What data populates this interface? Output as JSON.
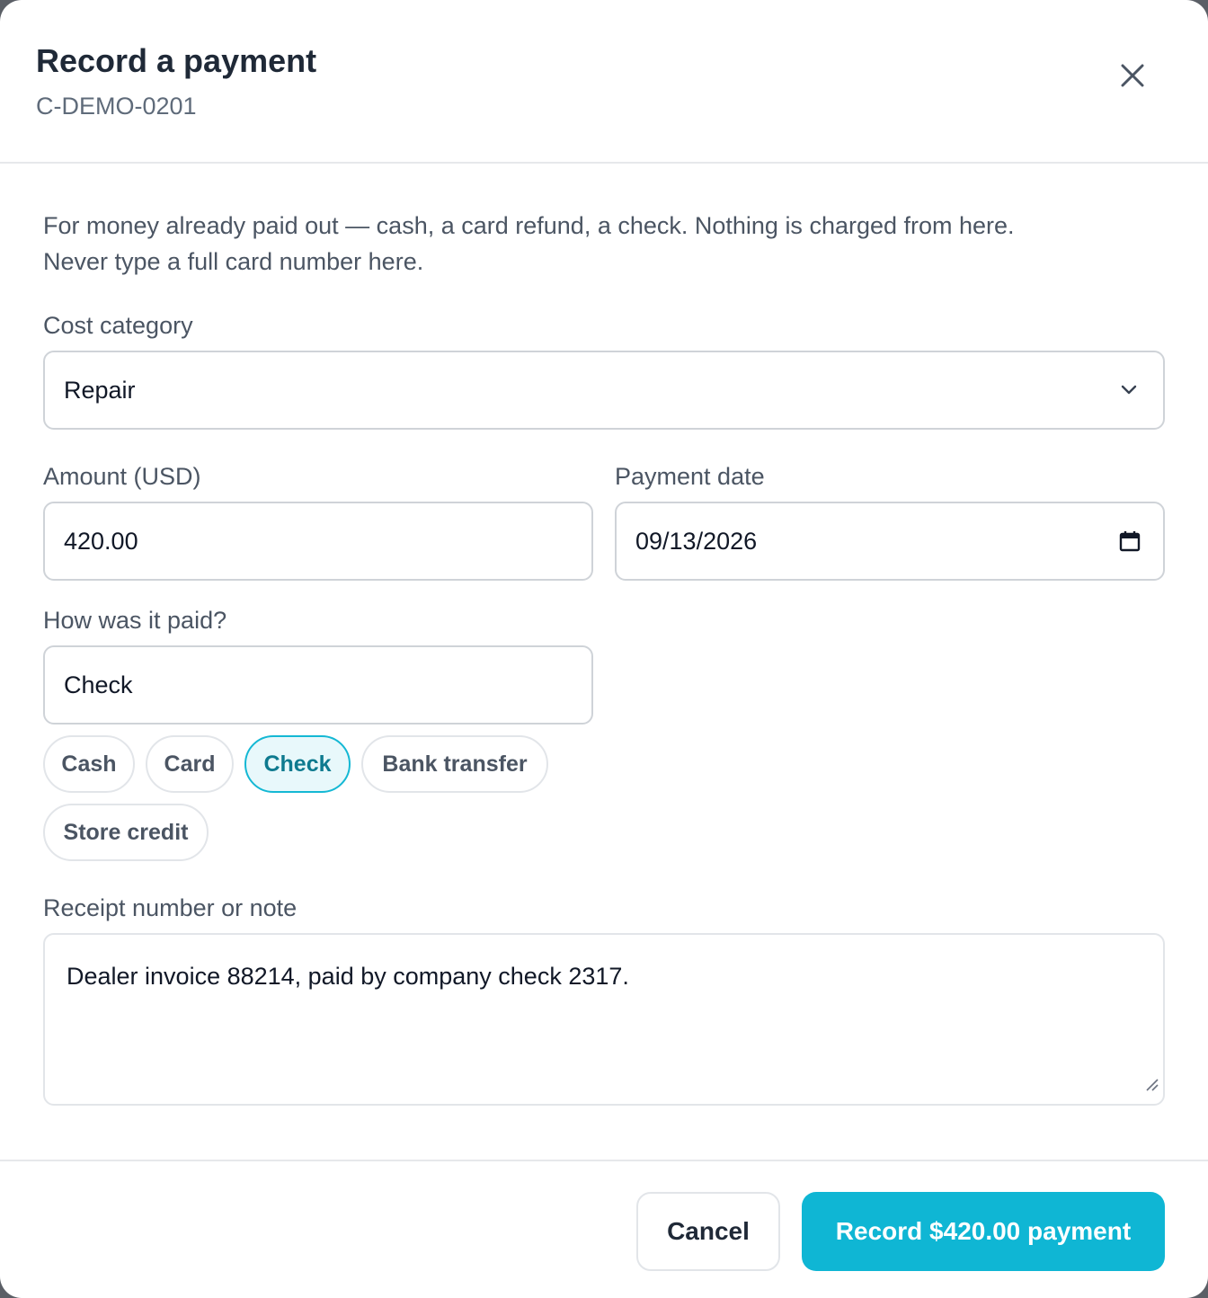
{
  "header": {
    "title": "Record a payment",
    "subtitle": "C-DEMO-0201"
  },
  "intro": {
    "line1": "For money already paid out — cash, a card refund, a check. Nothing is charged from here.",
    "line2": "Never type a full card number here."
  },
  "cost_category": {
    "label": "Cost category",
    "value": "Repair"
  },
  "amount": {
    "label": "Amount (USD)",
    "value": "420.00"
  },
  "payment_date": {
    "label": "Payment date",
    "value": "09/13/2026"
  },
  "method": {
    "label": "How was it paid?",
    "value": "Check",
    "options": [
      "Cash",
      "Card",
      "Check",
      "Bank transfer",
      "Store credit"
    ],
    "selected": "Check"
  },
  "note": {
    "label": "Receipt number or note",
    "value": "Dealer invoice 88214, paid by company check 2317."
  },
  "footer": {
    "cancel_label": "Cancel",
    "submit_label": "Record $420.00 payment"
  },
  "colors": {
    "accent": "#0fb6d4",
    "accent_chip_bg": "#e8f8fb",
    "accent_chip_text": "#0e7a8f"
  },
  "icons": {
    "close": "close-icon",
    "dropdown": "chevron-down-icon",
    "calendar": "calendar-icon",
    "resize": "resize-grip-icon"
  }
}
